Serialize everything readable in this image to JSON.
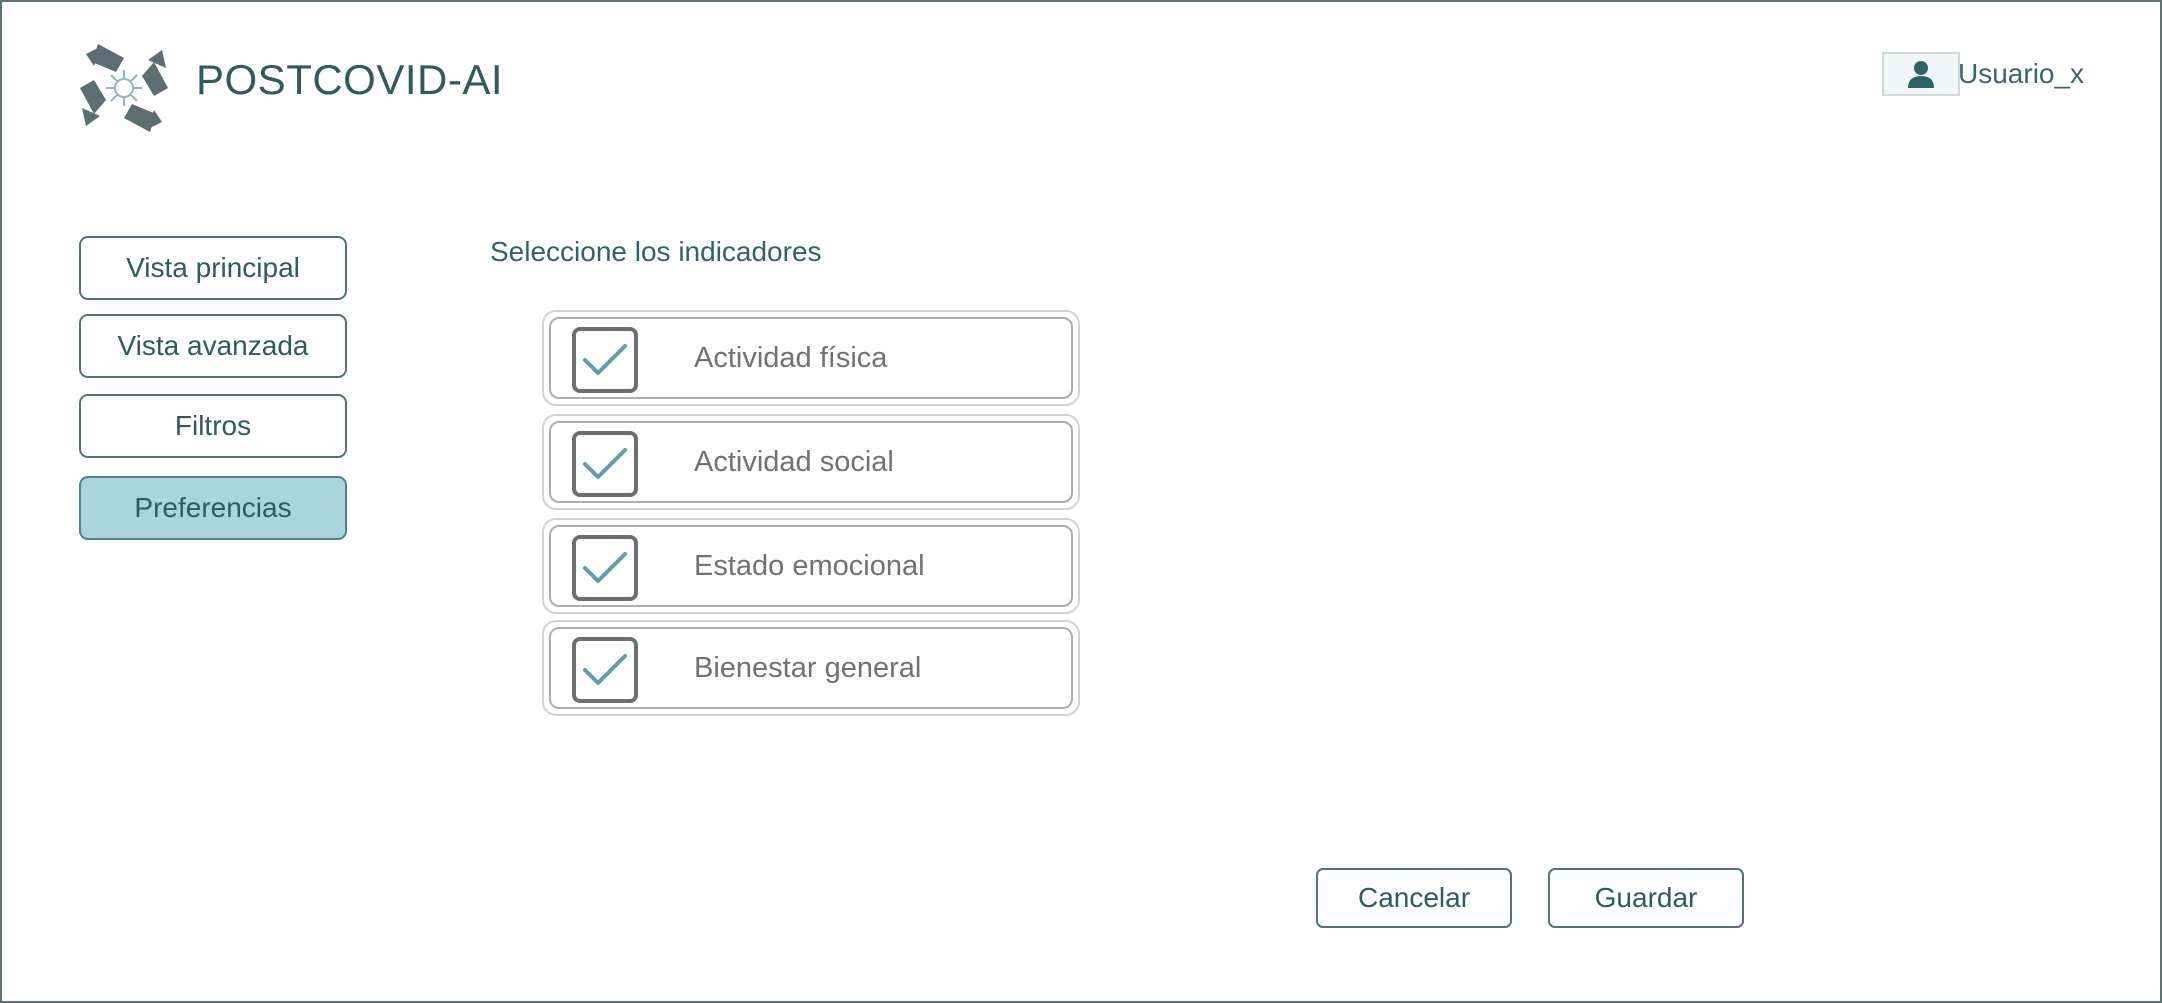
{
  "app": {
    "title": "POSTCOVID-AI",
    "logo_icon": "hands-circle-logo"
  },
  "user": {
    "name": "Usuario_x",
    "icon": "user-icon"
  },
  "sidebar": {
    "items": [
      {
        "label": "Vista principal",
        "active": false
      },
      {
        "label": "Vista avanzada",
        "active": false
      },
      {
        "label": "Filtros",
        "active": false
      },
      {
        "label": "Preferencias",
        "active": true
      }
    ]
  },
  "main": {
    "title": "Seleccione los indicadores",
    "indicators": [
      {
        "label": "Actividad física",
        "checked": true
      },
      {
        "label": "Actividad social",
        "checked": true
      },
      {
        "label": "Estado emocional",
        "checked": true
      },
      {
        "label": "Bienestar general",
        "checked": true
      }
    ]
  },
  "actions": {
    "cancel_label": "Cancelar",
    "save_label": "Guardar"
  },
  "colors": {
    "accent": "#2f5a5e",
    "active_bg": "#a8d6dc",
    "check": "#5f9ea6"
  }
}
